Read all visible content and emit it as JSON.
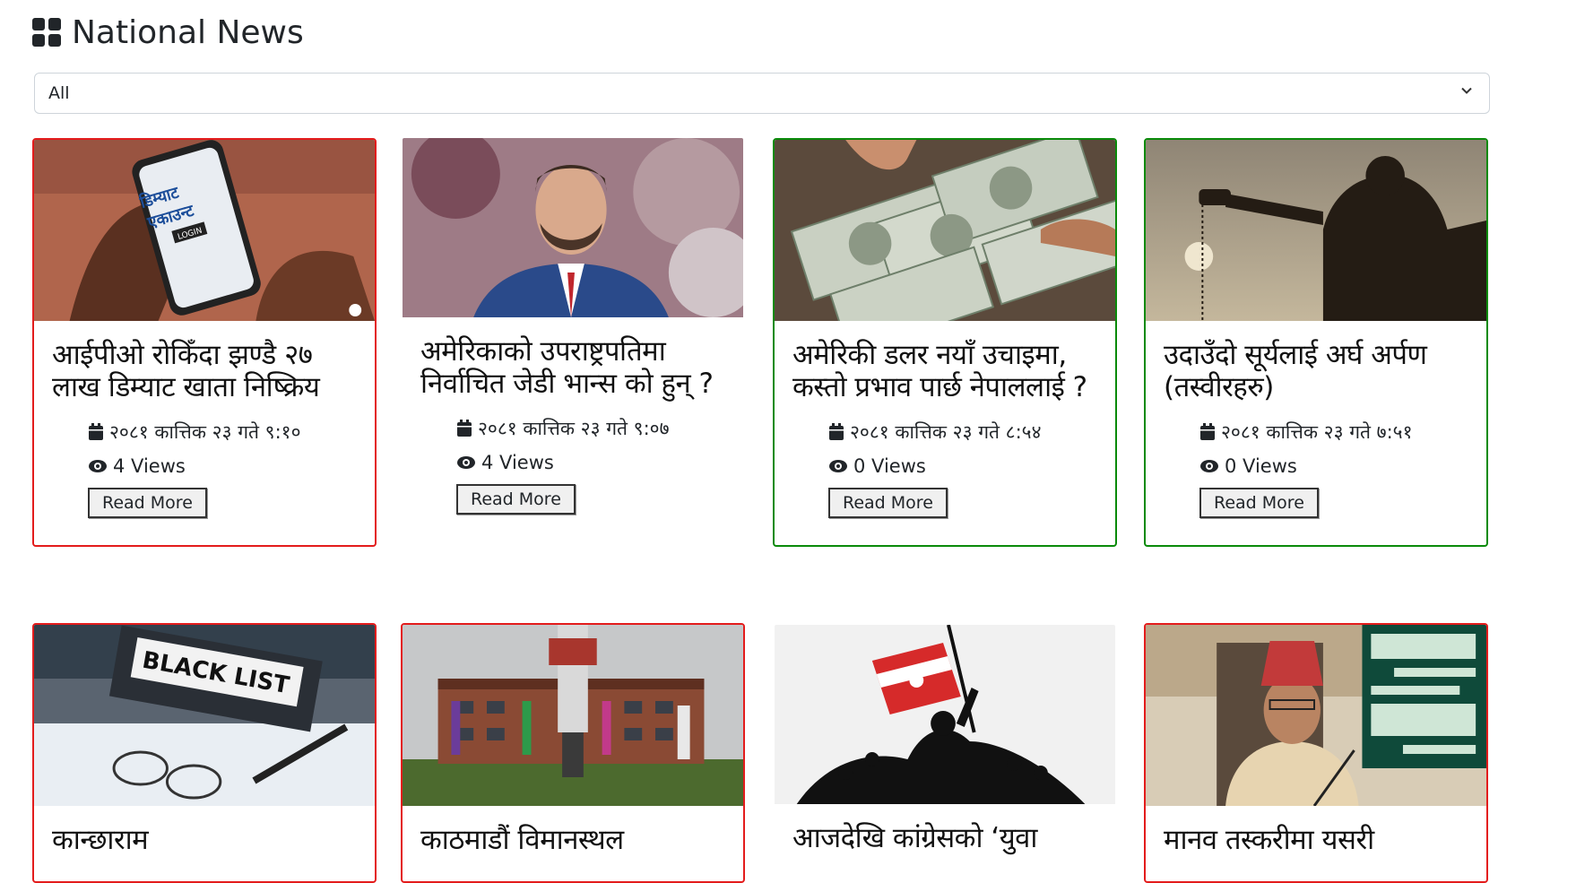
{
  "page": {
    "title": "National News",
    "title_icon": "grid-icon",
    "filter": {
      "selected": "All"
    }
  },
  "colors": {
    "border_red": "#e31c1c",
    "border_green": "#0a8a0a"
  },
  "articles": [
    {
      "title": "आईपीओ रोकिँदा झण्डै २७ लाख डिम्याट खाता निष्क्रिय",
      "date": "२०८१ कात्तिक २३ गते ९:१०",
      "views": "4 Views",
      "read_more": "Read More",
      "border": "red",
      "image_text_1": "डिम्याट",
      "image_text_2": "एकाउन्ट",
      "image_text_3": "LOGIN"
    },
    {
      "title": "अमेरिकाको उपराष्ट्रपतिमा निर्वाचित जेडी भान्स को हुन् ?",
      "date": "२०८१ कात्तिक २३ गते ९:०७",
      "views": "4 Views",
      "read_more": "Read More",
      "border": "none"
    },
    {
      "title": "अमेरिकी डलर नयाँ उचाइमा, कस्तो प्रभाव पार्छ नेपाललाई ?",
      "date": "२०८१ कात्तिक २३ गते ८:५४",
      "views": "0 Views",
      "read_more": "Read More",
      "border": "green"
    },
    {
      "title": "उदाउँदो सूर्यलाई अर्घ अर्पण (तस्वीरहरु)",
      "date": "२०८१ कात्तिक २३ गते ७:५१",
      "views": "0 Views",
      "read_more": "Read More",
      "border": "green"
    },
    {
      "title": "कान्छाराम",
      "border": "none",
      "image_text_1": "BLACK LIST"
    },
    {
      "title": "काठमाडौं विमानस्थल",
      "border": "red"
    },
    {
      "title": "आजदेखि कांग्रेसको ‘युवा",
      "border": "none"
    },
    {
      "title": "मानव तस्करीमा यसरी",
      "border": "red"
    }
  ]
}
